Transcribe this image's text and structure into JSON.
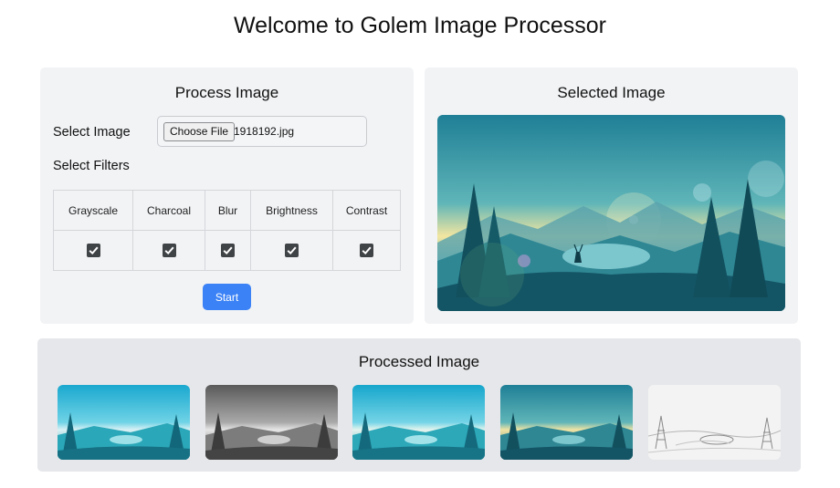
{
  "page": {
    "title": "Welcome to Golem Image Processor"
  },
  "process_panel": {
    "title": "Process Image",
    "select_image_label": "Select Image",
    "file_input": {
      "button_label": "Choose File",
      "file_name": "1918192.jpg"
    },
    "select_filters_label": "Select Filters",
    "filters": [
      {
        "name": "Grayscale",
        "checked": true
      },
      {
        "name": "Charcoal",
        "checked": true
      },
      {
        "name": "Blur",
        "checked": true
      },
      {
        "name": "Brightness",
        "checked": true
      },
      {
        "name": "Contrast",
        "checked": true
      }
    ],
    "start_label": "Start"
  },
  "selected_panel": {
    "title": "Selected Image"
  },
  "processed_panel": {
    "title": "Processed Image",
    "thumbnails": [
      "grayscale",
      "charcoal",
      "blur",
      "brightness",
      "contrast"
    ]
  }
}
